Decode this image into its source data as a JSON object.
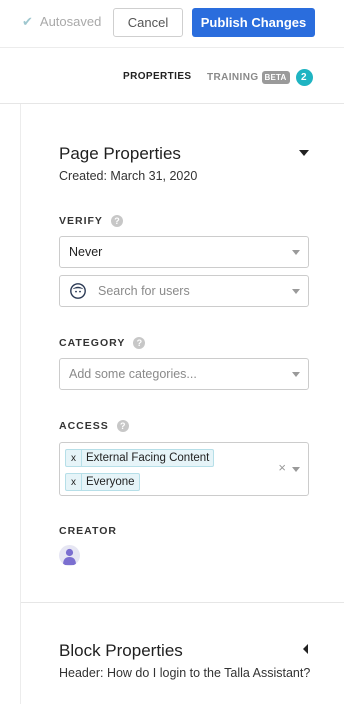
{
  "topbar": {
    "autosaved_label": "Autosaved",
    "cancel_label": "Cancel",
    "publish_label": "Publish Changes"
  },
  "tabs": {
    "properties_label": "PROPERTIES",
    "training_label": "TRAINING",
    "beta_label": "BETA",
    "training_count": "2"
  },
  "page_properties": {
    "title": "Page Properties",
    "created": "Created: March 31, 2020",
    "verify": {
      "label": "VERIFY",
      "help": "?",
      "selected": "Never",
      "user_search_placeholder": "Search for users"
    },
    "category": {
      "label": "CATEGORY",
      "help": "?",
      "placeholder": "Add some categories..."
    },
    "access": {
      "label": "ACCESS",
      "help": "?",
      "tags": [
        {
          "remove": "x",
          "label": "External Facing Content"
        },
        {
          "remove": "x",
          "label": "Everyone"
        }
      ],
      "clear": "×"
    },
    "creator": {
      "label": "CREATOR"
    }
  },
  "block_properties": {
    "title": "Block Properties",
    "subtitle": "Header: How do I login to the Talla Assistant?"
  },
  "colors": {
    "primary": "#2a6ddd",
    "badge_teal": "#1fb4c2",
    "tag_bg": "#e6f4f8",
    "avatar": "#7b6fd0"
  },
  "icons": {
    "autosaved": "check-icon",
    "help": "help-icon",
    "user": "user-icon",
    "avatar": "avatar-icon",
    "dropdown": "chevron-down-icon"
  }
}
